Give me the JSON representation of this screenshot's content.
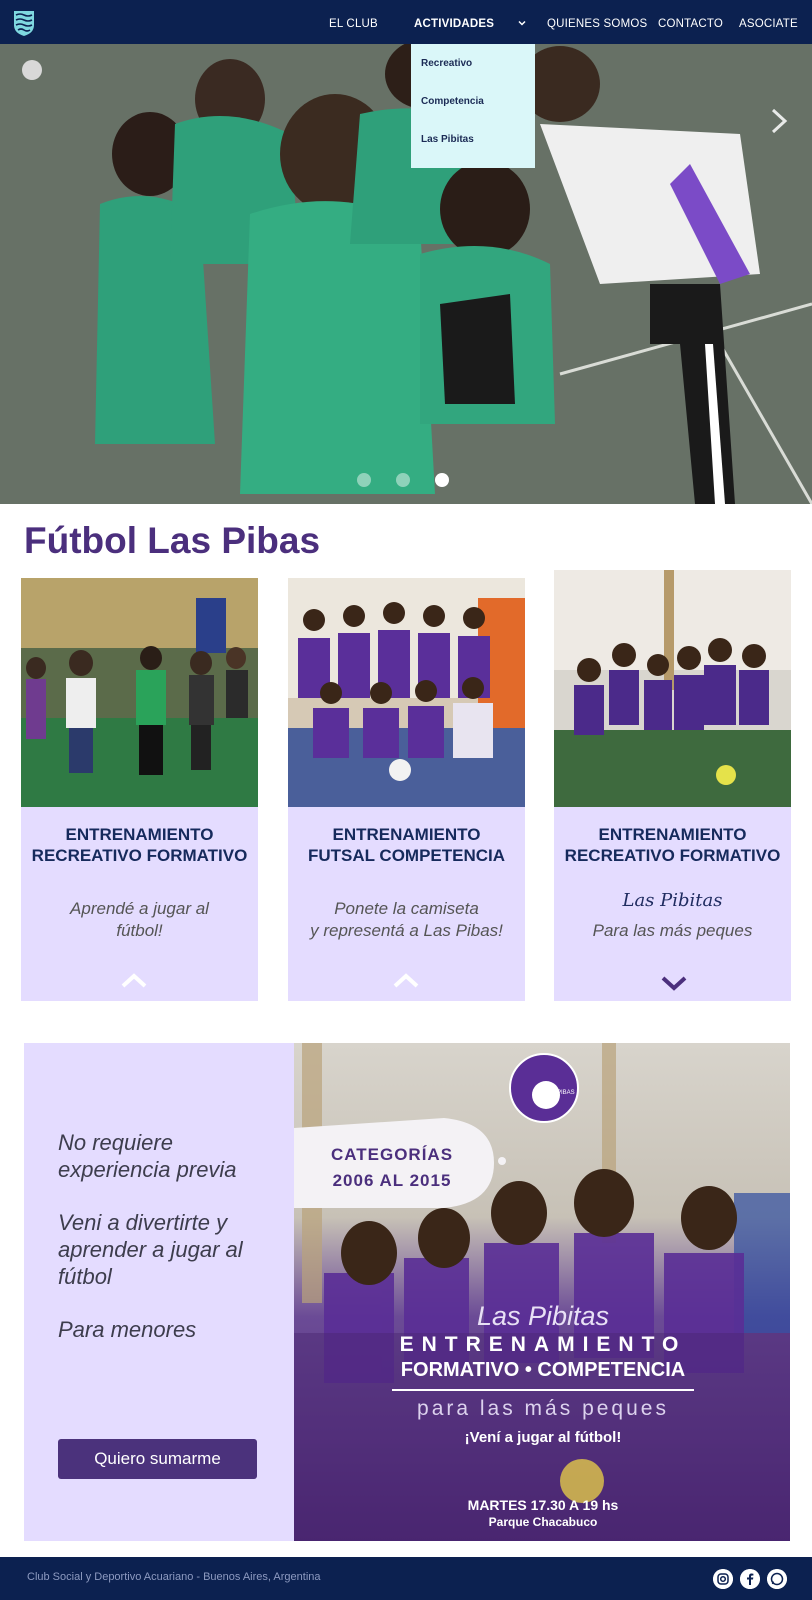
{
  "nav": {
    "items": [
      "EL CLUB",
      "ACTIVIDADES",
      "QUIENES SOMOS",
      "CONTACTO",
      "ASOCIATE"
    ],
    "active": "ACTIVIDADES",
    "dropdown": [
      "Recreativo",
      "Competencia",
      "Las Pibitas"
    ]
  },
  "hero": {
    "slides": 3,
    "active_slide": 3
  },
  "page": {
    "title": "Fútbol Las Pibas"
  },
  "cards": [
    {
      "heading_line1": "ENTRENAMIENTO",
      "heading_line2": "RECREATIVO FORMATIVO",
      "text_line1": "Aprendé a jugar al",
      "text_line2": "fútbol!",
      "icon": "chevron-up-icon"
    },
    {
      "heading_line1": "ENTRENAMIENTO",
      "heading_line2": "FUTSAL COMPETENCIA",
      "text_line1": "Ponete la camiseta",
      "text_line2": "y representá a Las Pibas!",
      "icon": "chevron-up-icon"
    },
    {
      "heading_line1": "ENTRENAMIENTO",
      "heading_line2": "RECREATIVO FORMATIVO",
      "script": "Las Pibitas",
      "text_line1": "Para las más peques",
      "icon": "chevron-down-icon"
    }
  ],
  "info": {
    "p1": "No requiere experiencia previa",
    "p2": "Veni a divertirte y aprender a jugar al fútbol",
    "p3": "Para menores",
    "button": "Quiero sumarme"
  },
  "poster": {
    "badge_text": "LAS PIBAS",
    "categories_line1": "CATEGORÍAS",
    "categories_line2": "2006 AL 2015",
    "script": "Las Pibitas",
    "line1": "ENTRENAMIENTO",
    "line2": "FORMATIVO • COMPETENCIA",
    "line3": "para las más peques",
    "line4": "¡Vení a jugar al fútbol!",
    "schedule": "MARTES 17.30 A 19 hs",
    "place": "Parque Chacabuco"
  },
  "footer": {
    "text": "Club Social y Deportivo Acuariano - Buenos Aires, Argentina",
    "icons": [
      "instagram-icon",
      "facebook-icon",
      "whatsapp-icon"
    ]
  },
  "colors": {
    "navy": "#0c2150",
    "purple": "#4b2f7d",
    "lavender": "#e4dcff",
    "dropdown_bg": "#daf7f9"
  }
}
